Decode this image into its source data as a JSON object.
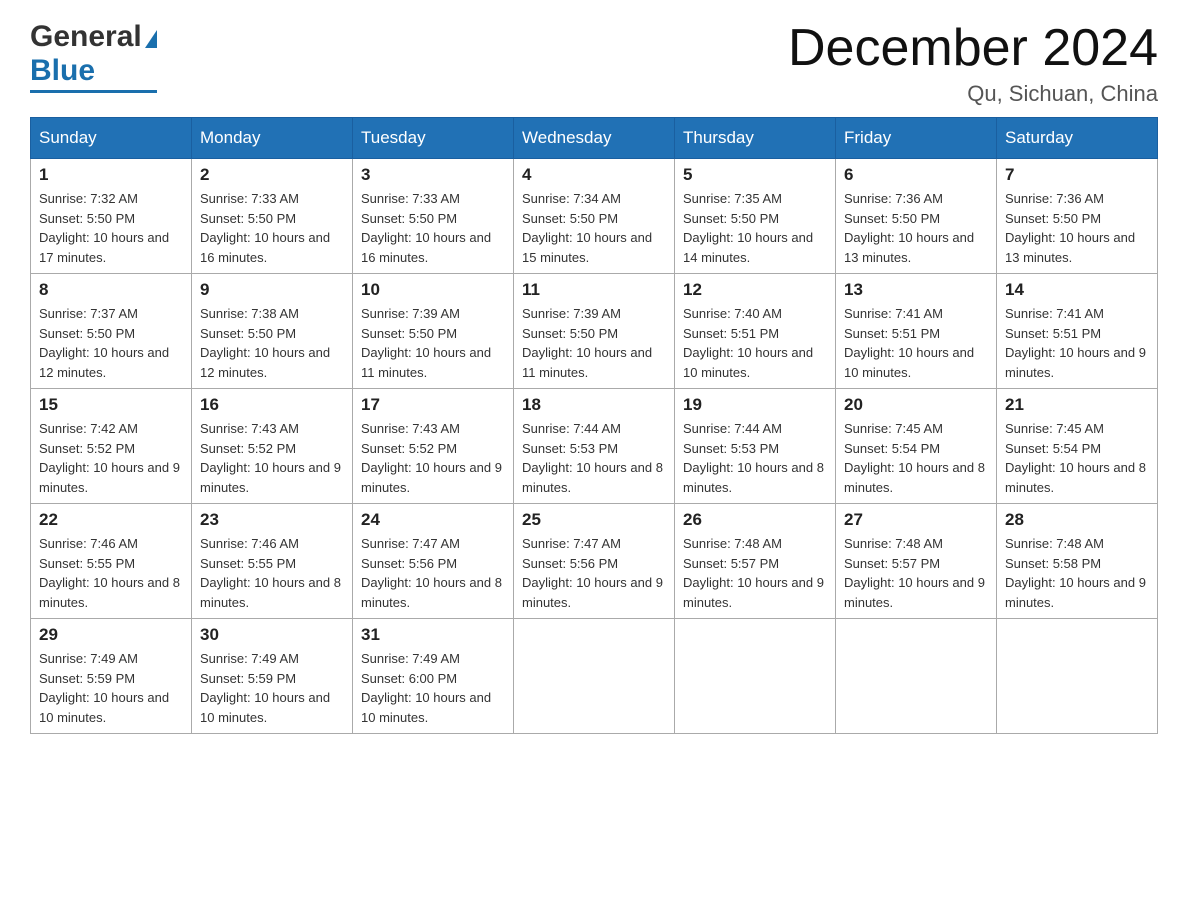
{
  "header": {
    "logo_general": "General",
    "logo_blue": "Blue",
    "month_title": "December 2024",
    "location": "Qu, Sichuan, China"
  },
  "calendar": {
    "days": [
      "Sunday",
      "Monday",
      "Tuesday",
      "Wednesday",
      "Thursday",
      "Friday",
      "Saturday"
    ],
    "weeks": [
      [
        {
          "day": "1",
          "sunrise": "7:32 AM",
          "sunset": "5:50 PM",
          "daylight": "10 hours and 17 minutes."
        },
        {
          "day": "2",
          "sunrise": "7:33 AM",
          "sunset": "5:50 PM",
          "daylight": "10 hours and 16 minutes."
        },
        {
          "day": "3",
          "sunrise": "7:33 AM",
          "sunset": "5:50 PM",
          "daylight": "10 hours and 16 minutes."
        },
        {
          "day": "4",
          "sunrise": "7:34 AM",
          "sunset": "5:50 PM",
          "daylight": "10 hours and 15 minutes."
        },
        {
          "day": "5",
          "sunrise": "7:35 AM",
          "sunset": "5:50 PM",
          "daylight": "10 hours and 14 minutes."
        },
        {
          "day": "6",
          "sunrise": "7:36 AM",
          "sunset": "5:50 PM",
          "daylight": "10 hours and 13 minutes."
        },
        {
          "day": "7",
          "sunrise": "7:36 AM",
          "sunset": "5:50 PM",
          "daylight": "10 hours and 13 minutes."
        }
      ],
      [
        {
          "day": "8",
          "sunrise": "7:37 AM",
          "sunset": "5:50 PM",
          "daylight": "10 hours and 12 minutes."
        },
        {
          "day": "9",
          "sunrise": "7:38 AM",
          "sunset": "5:50 PM",
          "daylight": "10 hours and 12 minutes."
        },
        {
          "day": "10",
          "sunrise": "7:39 AM",
          "sunset": "5:50 PM",
          "daylight": "10 hours and 11 minutes."
        },
        {
          "day": "11",
          "sunrise": "7:39 AM",
          "sunset": "5:50 PM",
          "daylight": "10 hours and 11 minutes."
        },
        {
          "day": "12",
          "sunrise": "7:40 AM",
          "sunset": "5:51 PM",
          "daylight": "10 hours and 10 minutes."
        },
        {
          "day": "13",
          "sunrise": "7:41 AM",
          "sunset": "5:51 PM",
          "daylight": "10 hours and 10 minutes."
        },
        {
          "day": "14",
          "sunrise": "7:41 AM",
          "sunset": "5:51 PM",
          "daylight": "10 hours and 9 minutes."
        }
      ],
      [
        {
          "day": "15",
          "sunrise": "7:42 AM",
          "sunset": "5:52 PM",
          "daylight": "10 hours and 9 minutes."
        },
        {
          "day": "16",
          "sunrise": "7:43 AM",
          "sunset": "5:52 PM",
          "daylight": "10 hours and 9 minutes."
        },
        {
          "day": "17",
          "sunrise": "7:43 AM",
          "sunset": "5:52 PM",
          "daylight": "10 hours and 9 minutes."
        },
        {
          "day": "18",
          "sunrise": "7:44 AM",
          "sunset": "5:53 PM",
          "daylight": "10 hours and 8 minutes."
        },
        {
          "day": "19",
          "sunrise": "7:44 AM",
          "sunset": "5:53 PM",
          "daylight": "10 hours and 8 minutes."
        },
        {
          "day": "20",
          "sunrise": "7:45 AM",
          "sunset": "5:54 PM",
          "daylight": "10 hours and 8 minutes."
        },
        {
          "day": "21",
          "sunrise": "7:45 AM",
          "sunset": "5:54 PM",
          "daylight": "10 hours and 8 minutes."
        }
      ],
      [
        {
          "day": "22",
          "sunrise": "7:46 AM",
          "sunset": "5:55 PM",
          "daylight": "10 hours and 8 minutes."
        },
        {
          "day": "23",
          "sunrise": "7:46 AM",
          "sunset": "5:55 PM",
          "daylight": "10 hours and 8 minutes."
        },
        {
          "day": "24",
          "sunrise": "7:47 AM",
          "sunset": "5:56 PM",
          "daylight": "10 hours and 8 minutes."
        },
        {
          "day": "25",
          "sunrise": "7:47 AM",
          "sunset": "5:56 PM",
          "daylight": "10 hours and 9 minutes."
        },
        {
          "day": "26",
          "sunrise": "7:48 AM",
          "sunset": "5:57 PM",
          "daylight": "10 hours and 9 minutes."
        },
        {
          "day": "27",
          "sunrise": "7:48 AM",
          "sunset": "5:57 PM",
          "daylight": "10 hours and 9 minutes."
        },
        {
          "day": "28",
          "sunrise": "7:48 AM",
          "sunset": "5:58 PM",
          "daylight": "10 hours and 9 minutes."
        }
      ],
      [
        {
          "day": "29",
          "sunrise": "7:49 AM",
          "sunset": "5:59 PM",
          "daylight": "10 hours and 10 minutes."
        },
        {
          "day": "30",
          "sunrise": "7:49 AM",
          "sunset": "5:59 PM",
          "daylight": "10 hours and 10 minutes."
        },
        {
          "day": "31",
          "sunrise": "7:49 AM",
          "sunset": "6:00 PM",
          "daylight": "10 hours and 10 minutes."
        },
        null,
        null,
        null,
        null
      ]
    ]
  }
}
